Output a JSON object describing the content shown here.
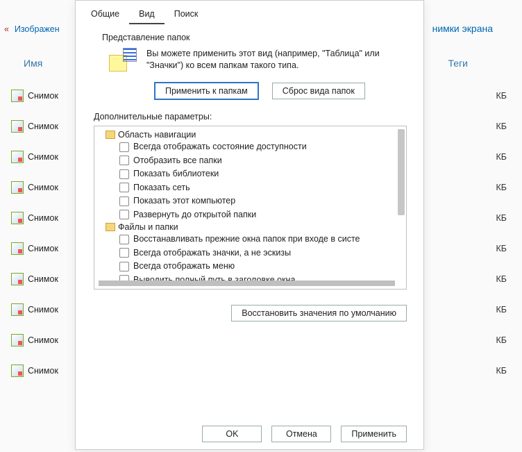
{
  "explorer": {
    "breadcrumb_back": "«",
    "breadcrumb_label": "Изображен",
    "breadcrumb_right": "нимки экрана",
    "col_name": "Имя",
    "col_tags": "Теги",
    "files": [
      {
        "name": "Снимок",
        "size": "КБ"
      },
      {
        "name": "Снимок",
        "size": "КБ"
      },
      {
        "name": "Снимок",
        "size": "КБ"
      },
      {
        "name": "Снимок",
        "size": "КБ"
      },
      {
        "name": "Снимок",
        "size": "КБ"
      },
      {
        "name": "Снимок",
        "size": "КБ"
      },
      {
        "name": "Снимок",
        "size": "КБ"
      },
      {
        "name": "Снимок",
        "size": "КБ"
      },
      {
        "name": "Снимок",
        "size": "КБ"
      },
      {
        "name": "Снимок",
        "size": "КБ"
      }
    ]
  },
  "dialog": {
    "tabs": {
      "general": "Общие",
      "view": "Вид",
      "search": "Поиск"
    },
    "folder_views": {
      "heading": "Представление папок",
      "desc": "Вы можете применить этот вид (например, \"Таблица\" или \"Значки\") ко всем папкам такого типа.",
      "apply_btn": "Применить к папкам",
      "reset_btn": "Сброс вида папок"
    },
    "advanced": {
      "label": "Дополнительные параметры:",
      "group_nav": "Область навигации",
      "nav_items": [
        "Всегда отображать состояние доступности",
        "Отобразить все папки",
        "Показать библиотеки",
        "Показать сеть",
        "Показать этот компьютер",
        "Развернуть до открытой папки"
      ],
      "group_files": "Файлы и папки",
      "files_items": [
        "Восстанавливать прежние окна папок при входе в систе",
        "Всегда отображать значки, а не эскизы",
        "Всегда отображать меню",
        "Выводить полный путь в заголовке окна"
      ],
      "restore_btn": "Восстановить значения по умолчанию"
    },
    "footer": {
      "ok": "OK",
      "cancel": "Отмена",
      "apply": "Применить"
    }
  }
}
